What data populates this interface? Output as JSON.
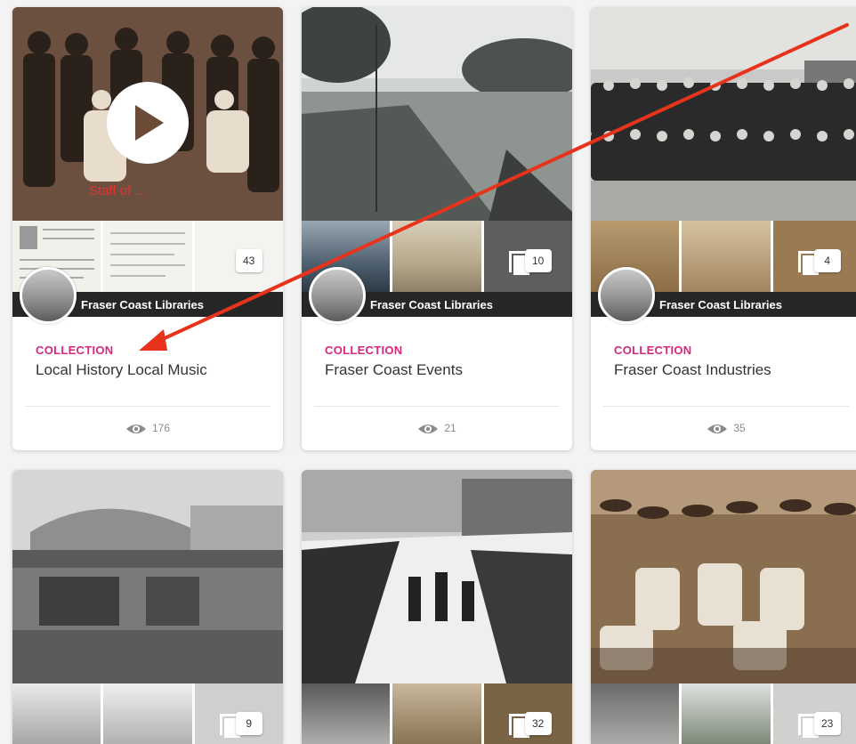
{
  "cards": [
    {
      "owner": "Fraser Coast Libraries",
      "type": "COLLECTION",
      "title": "Local History Local Music",
      "count": "43",
      "views": "176",
      "caption": "Staff of ..."
    },
    {
      "owner": "Fraser Coast Libraries",
      "type": "COLLECTION",
      "title": "Fraser Coast Events",
      "count": "10",
      "views": "21"
    },
    {
      "owner": "Fraser Coast Libraries",
      "type": "COLLECTION",
      "title": "Fraser Coast Industries",
      "count": "4",
      "views": "35"
    },
    {
      "count": "9"
    },
    {
      "count": "32"
    },
    {
      "count": "23"
    }
  ],
  "icons": {
    "play": "play-icon",
    "views": "eye-icon",
    "stack": "stack-icon"
  },
  "colors": {
    "accent": "#d6287e",
    "arrow": "#e8331c"
  }
}
